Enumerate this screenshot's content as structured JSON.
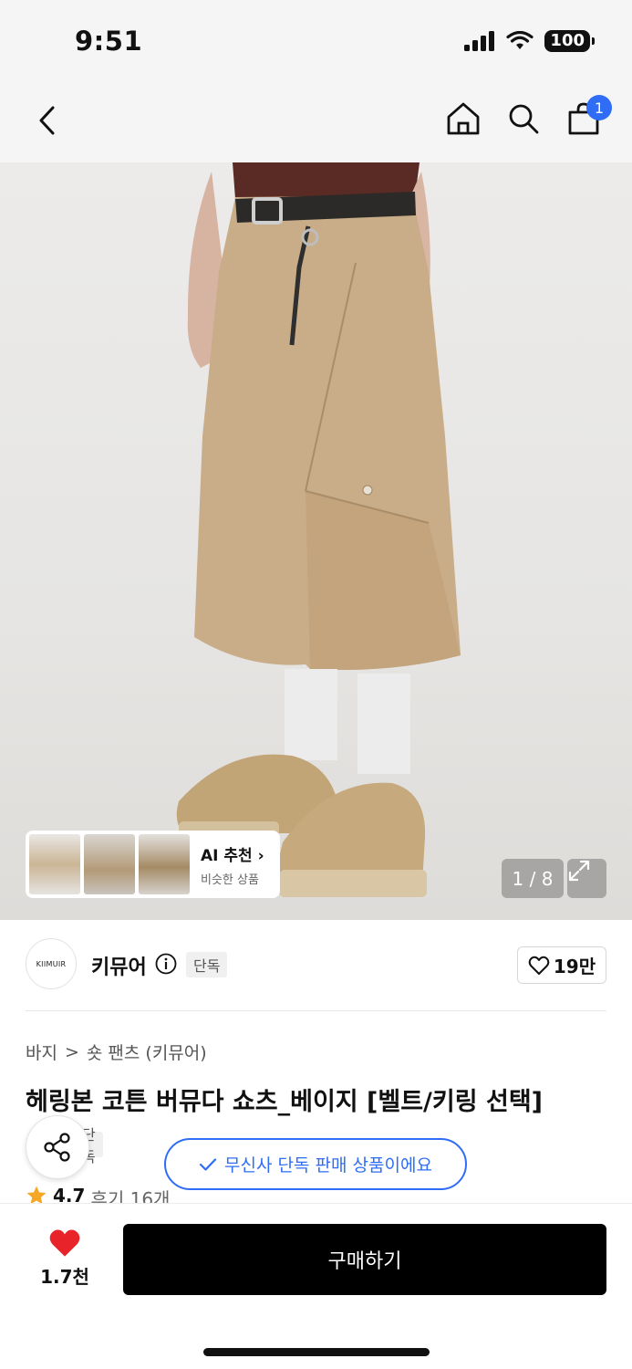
{
  "status_bar": {
    "time": "9:51",
    "battery": "100"
  },
  "nav": {
    "cart_count": "1"
  },
  "gallery": {
    "counter": "1 / 8",
    "ai_card": {
      "title": "AI 추천",
      "subtitle": "비슷한 상품"
    }
  },
  "brand": {
    "logo_text": "KIIMUIR",
    "name": "키뮤어",
    "tag": "단독",
    "likes": "19만"
  },
  "breadcrumb": {
    "category": "바지",
    "separator": ">",
    "subcategory": "숏 팬츠 (키뮤어)"
  },
  "product": {
    "title": "헤링본 코튼 버뮤다 쇼츠_베이지 [벨트/키링 선택]",
    "tag": "단독",
    "rating": "4.7",
    "reviews": "후기 16개"
  },
  "toast": {
    "text": "무신사 단독 판매 상품이에요"
  },
  "bottom": {
    "wish_count": "1.7천",
    "buy_label": "구매하기"
  },
  "colors": {
    "accent_blue": "#2f6df6",
    "heart_red": "#e8232a",
    "star_orange": "#f5a623",
    "buy_button": "#000000"
  }
}
